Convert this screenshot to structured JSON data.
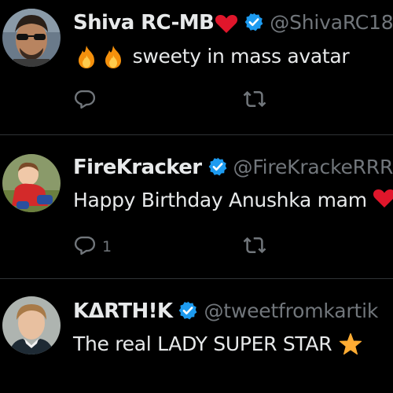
{
  "colors": {
    "background": "#000000",
    "text_primary": "#e7e9ea",
    "text_secondary": "#71767b",
    "verified_badge": "#1d9bf0",
    "divider": "#2f3336",
    "heart": "#f91880"
  },
  "tweets": [
    {
      "name": "Shiva RC-MB",
      "name_emoji": "heart-icon",
      "handle": "@ShivaRC18",
      "verified": true,
      "text_prefix_emoji": "fire-icon",
      "text": "sweety in mass avatar",
      "reply_count": "",
      "actions": [
        "reply-icon",
        "retweet-icon"
      ]
    },
    {
      "name": "FireKracker",
      "handle": "@FireKrackeRRR",
      "verified": true,
      "text": "Happy Birthday Anushka mam",
      "text_suffix_emoji": "heart-icon",
      "reply_count": "1",
      "actions": [
        "reply-icon",
        "retweet-icon"
      ]
    },
    {
      "name": "KΔRTH!K",
      "handle": "@tweetfromkartik",
      "verified": true,
      "text": "The real LADY SUPER STAR",
      "text_suffix_emoji": "star-icon"
    }
  ]
}
